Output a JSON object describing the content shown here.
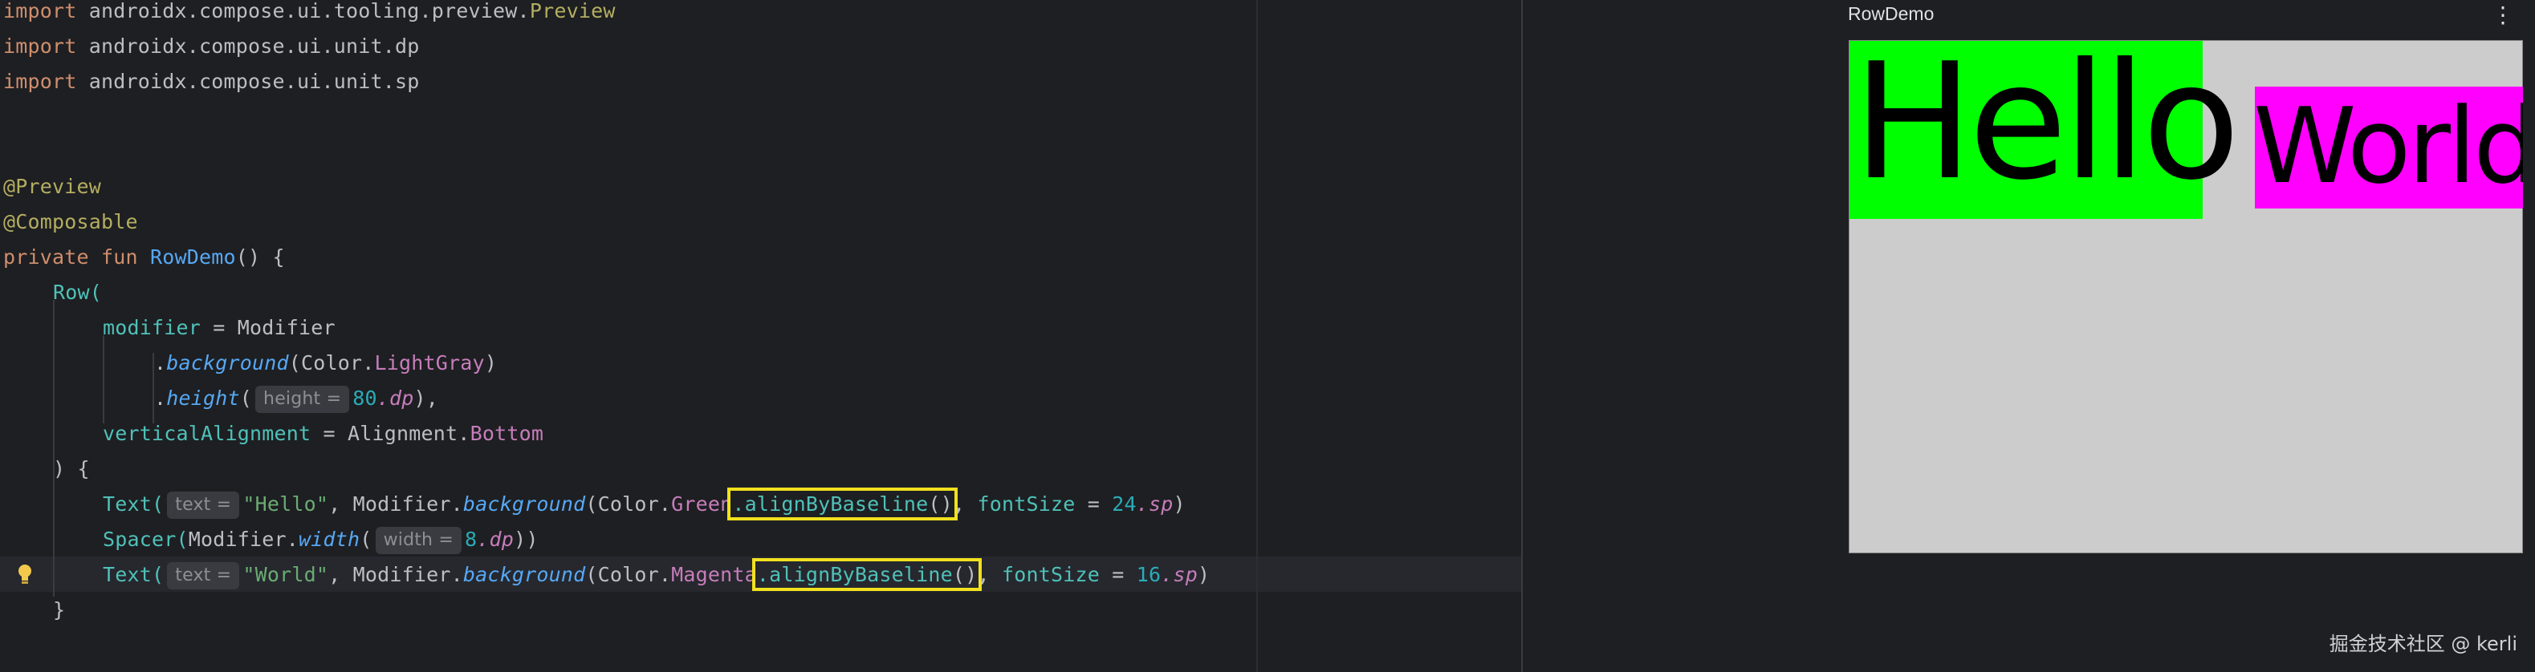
{
  "code": {
    "line1": {
      "kw": "import",
      "path": " androidx.compose.ui.tooling.preview.",
      "cls": "Preview"
    },
    "line2": {
      "kw": "import",
      "path": " androidx.compose.ui.unit.dp"
    },
    "line3": {
      "kw": "import",
      "path": " androidx.compose.ui.unit.sp"
    },
    "ann1": "@Preview",
    "ann2": "@Composable",
    "fun_decl": {
      "kw": "private fun",
      "name": "RowDemo",
      "rest": "() {"
    },
    "row_call": "Row(",
    "modifier_line": {
      "name": "modifier",
      "rest": " = Modifier"
    },
    "background_line": {
      "dot": ".",
      "fn": "background",
      "open": "(Color.",
      "color": "LightGray",
      "close": ")"
    },
    "height_line": {
      "dot": ".",
      "fn": "height",
      "open": "(",
      "hint": "height =",
      "num": "80",
      "ext": ".dp",
      "close": "),"
    },
    "valign_line": {
      "name": "verticalAlignment",
      "rest": " = Alignment.",
      "val": "Bottom"
    },
    "close_row_params": ") {",
    "text1": {
      "call": "Text(",
      "hint": "text =",
      "str": "\"Hello\"",
      "mid": ", Modifier.",
      "fn": "background",
      "open": "(Color.",
      "color": "Green",
      "align": ".alignByBaseline",
      "paren": "()",
      "after": ", ",
      "named": "fontSize",
      "eq": " = ",
      "num": "24",
      "ext": ".sp",
      "close": ")"
    },
    "spacer": {
      "call": "Spacer(",
      "mid": "Modifier.",
      "fn": "width",
      "open": "(",
      "hint": "width =",
      "num": "8",
      "ext": ".dp",
      "close": "))"
    },
    "text2": {
      "call": "Text(",
      "hint": "text =",
      "str": "\"World\"",
      "mid": ", Modifier.",
      "fn": "background",
      "open": "(Color.",
      "color": "Magenta",
      "align": ".alignByBaseline",
      "paren": "()",
      "after": ", ",
      "named": "fontSize",
      "eq": " = ",
      "num": "16",
      "ext": ".sp",
      "close": ")"
    },
    "close_brace": "}"
  },
  "preview": {
    "title": "RowDemo",
    "menu_glyph": "⋮",
    "hello": "Hello",
    "world": "World",
    "colors": {
      "green": "#00ff00",
      "magenta": "#ff00ff",
      "lightgray": "#cccccc",
      "highlight": "#f2e11e"
    }
  },
  "watermark": "掘金技术社区 @ kerli"
}
